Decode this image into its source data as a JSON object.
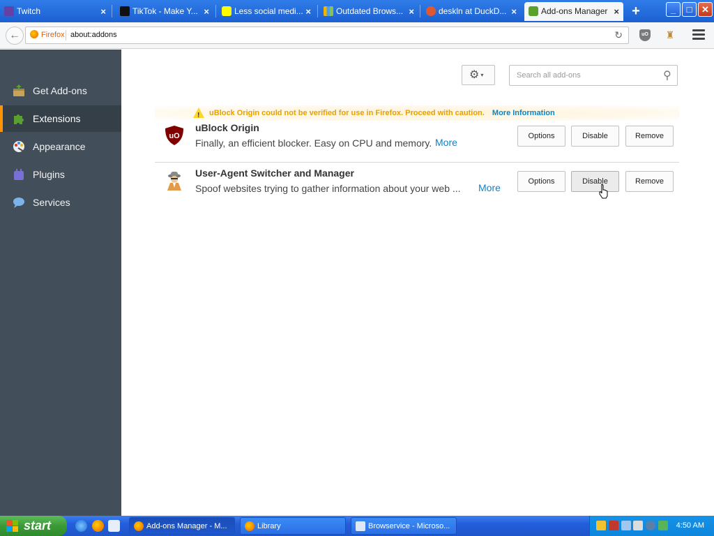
{
  "tabs": [
    {
      "title": "Twitch",
      "icon": "twitch-icon",
      "active": false
    },
    {
      "title": "TikTok - Make Y...",
      "icon": "tiktok-icon",
      "active": false
    },
    {
      "title": "Less social medi...",
      "icon": "snapchat-icon",
      "active": false
    },
    {
      "title": "Outdated Brows...",
      "icon": "bars-icon",
      "active": false
    },
    {
      "title": "deskln at DuckD...",
      "icon": "duckduckgo-icon",
      "active": false
    },
    {
      "title": "Add-ons Manager",
      "icon": "puzzle-icon",
      "active": true
    }
  ],
  "tab_close_glyph": "×",
  "new_tab_glyph": "+",
  "window_controls": {
    "minimize": "_",
    "maximize": "□",
    "close": "✕"
  },
  "navbar": {
    "identity_label": "Firefox",
    "url": "about:addons",
    "reload_glyph": "↻",
    "ublock_badge": "uO"
  },
  "sidebar": {
    "items": [
      {
        "label": "Get Add-ons",
        "icon": "get-addons-icon",
        "selected": false
      },
      {
        "label": "Extensions",
        "icon": "puzzle-icon",
        "selected": true
      },
      {
        "label": "Appearance",
        "icon": "paint-palette-icon",
        "selected": false
      },
      {
        "label": "Plugins",
        "icon": "plugin-icon",
        "selected": false
      },
      {
        "label": "Services",
        "icon": "chat-bubble-icon",
        "selected": false
      }
    ]
  },
  "toolbar": {
    "gear_glyph": "⚙",
    "caret_glyph": "▾",
    "search_placeholder": "Search all add-ons",
    "search_value": "",
    "search_glyph": "⚲"
  },
  "warning": {
    "glyph": "!",
    "text": "uBlock Origin could not be verified for use in Firefox. Proceed with caution.",
    "link": "More Information"
  },
  "addons": [
    {
      "name": "uBlock Origin",
      "description": "Finally, an efficient blocker. Easy on CPU and memory.",
      "more": "More",
      "buttons": {
        "options": "Options",
        "disable": "Disable",
        "remove": "Remove"
      },
      "icon": "ublock-shield-icon"
    },
    {
      "name": "User-Agent Switcher and Manager",
      "description": "Spoof websites trying to gather information about your web ...",
      "more": "More",
      "buttons": {
        "options": "Options",
        "disable": "Disable",
        "remove": "Remove"
      },
      "icon": "spy-agent-icon"
    }
  ],
  "taskbar": {
    "start_label": "start",
    "tasks": [
      {
        "label": "Add-ons Manager - M...",
        "icon": "firefox-icon",
        "active": true
      },
      {
        "label": "Library",
        "icon": "firefox-icon",
        "active": false
      },
      {
        "label": "Browservice - Microso...",
        "icon": "window-icon",
        "active": false
      }
    ],
    "clock": "4:50 AM"
  },
  "colors": {
    "tabstrip": "#1c60d2",
    "sidebar_bg": "#424f5a",
    "sidebar_selected_accent": "#ff9400",
    "warning_text": "#e5a200",
    "link": "#0a84c8",
    "taskbar": "#245edb",
    "start_button": "#3a9a36"
  }
}
